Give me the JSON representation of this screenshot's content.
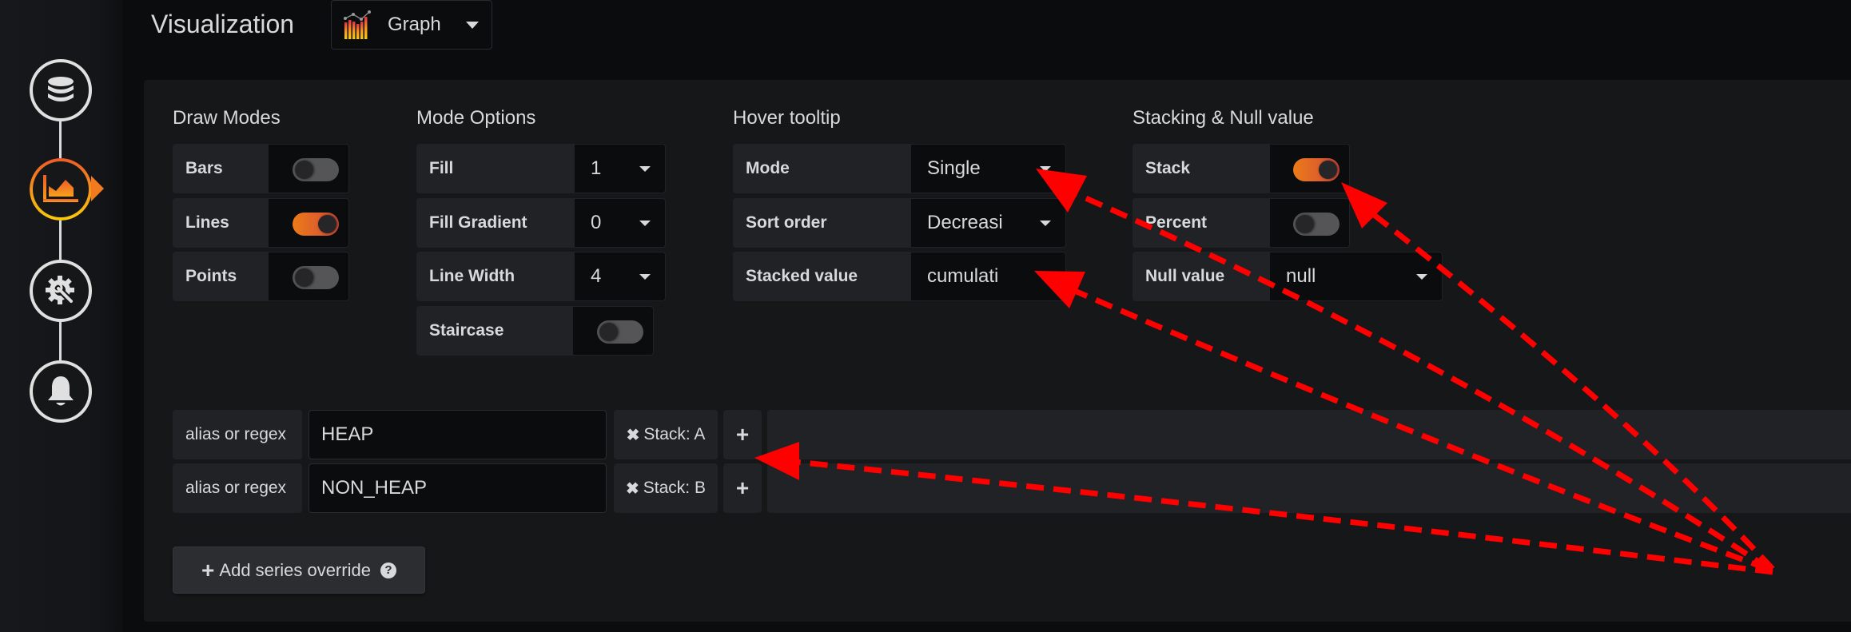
{
  "header": {
    "title": "Visualization",
    "visualization_picker": {
      "selected": "Graph",
      "icon": "graph-panel-icon"
    }
  },
  "sidebar": {
    "steps": [
      {
        "name": "queries",
        "icon": "database-icon",
        "active": false
      },
      {
        "name": "visualization",
        "icon": "area-chart-icon",
        "active": true
      },
      {
        "name": "general",
        "icon": "gear-wrench-icon",
        "active": false
      },
      {
        "name": "alert",
        "icon": "bell-icon",
        "active": false
      }
    ]
  },
  "draw_modes": {
    "heading": "Draw Modes",
    "items": [
      {
        "label": "Bars",
        "on": false
      },
      {
        "label": "Lines",
        "on": true
      },
      {
        "label": "Points",
        "on": false
      }
    ]
  },
  "mode_options": {
    "heading": "Mode Options",
    "fill": {
      "label": "Fill",
      "value": "1"
    },
    "fill_gradient": {
      "label": "Fill Gradient",
      "value": "0"
    },
    "line_width": {
      "label": "Line Width",
      "value": "4"
    },
    "staircase": {
      "label": "Staircase",
      "on": false
    }
  },
  "hover_tooltip": {
    "heading": "Hover tooltip",
    "mode": {
      "label": "Mode",
      "value": "Single"
    },
    "sort_order": {
      "label": "Sort order",
      "value": "Decreasi"
    },
    "stacked_value": {
      "label": "Stacked value",
      "value": "cumulati"
    }
  },
  "stacking": {
    "heading": "Stacking & Null value",
    "stack": {
      "label": "Stack",
      "on": true
    },
    "percent": {
      "label": "Percent",
      "on": false
    },
    "null_value": {
      "label": "Null value",
      "value": "null"
    }
  },
  "series_overrides": [
    {
      "label": "alias or regex",
      "value": "HEAP",
      "override_x": "✖",
      "override": "Stack: A",
      "add": "+"
    },
    {
      "label": "alias or regex",
      "value": "NON_HEAP",
      "override_x": "✖",
      "override": "Stack: B",
      "add": "+"
    }
  ],
  "add_override_button": {
    "plus": "+",
    "label": "Add series override",
    "help": "?"
  },
  "colors": {
    "accent_orange": "#eb7b18",
    "toggle_off": "#555557",
    "annotation_red": "#ff0000"
  }
}
